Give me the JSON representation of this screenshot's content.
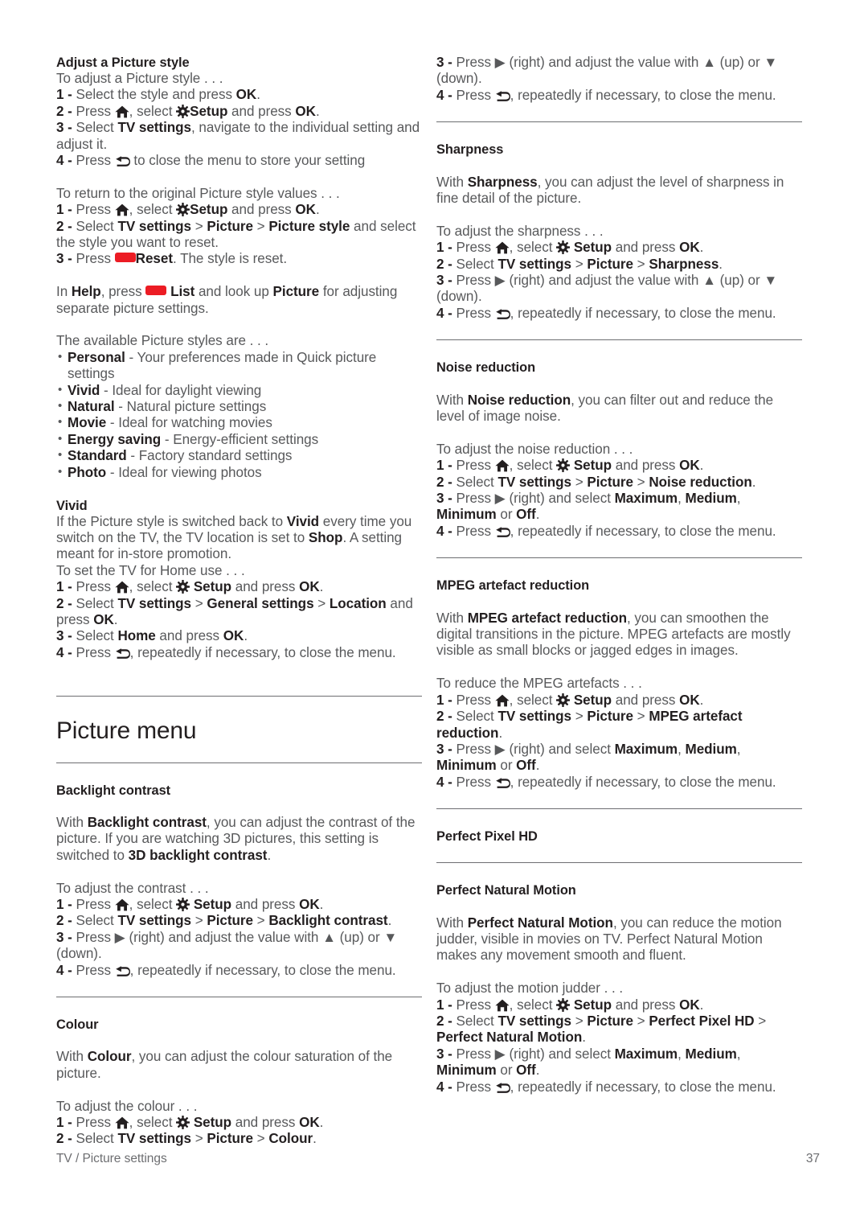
{
  "footer": {
    "breadcrumb": "TV / Picture settings",
    "page_number": "37"
  },
  "icons": {
    "home": "home-icon",
    "setup_gear": "gear-icon",
    "back": "back-arrow-icon",
    "red_key": "red-colour-key",
    "right": "▶",
    "up": "▲",
    "down": "▼"
  },
  "colors": {
    "red_key": "#ec1c24",
    "body_text": "#58595b",
    "heading_text": "#231f20",
    "rule": "#6d6e71"
  },
  "left_column": {
    "adjust_style": {
      "heading": "Adjust a Picture style",
      "intro": "To adjust a Picture style . . .",
      "step1_num": "1 -",
      "step1_a": "Select the style and press ",
      "step1_ok": "OK",
      "step1_end": ".",
      "step2_num": "2 -",
      "step2_a": "Press ",
      "step2_b": ", select ",
      "step2_setup": "Setup",
      "step2_c": " and press ",
      "step2_ok": "OK",
      "step2_end": ".",
      "step3_num": "3 -",
      "step3_a": "Select ",
      "step3_tv": "TV settings",
      "step3_b": ", navigate to the individual setting and adjust it.",
      "step4_num": "4 -",
      "step4_a": "Press ",
      "step4_b": " to close the menu to store your setting"
    },
    "return_original": {
      "intro": "To return to the original Picture style values . . .",
      "step1_num": "1 -",
      "step1_a": "Press ",
      "step1_b": ", select ",
      "step1_setup": "Setup",
      "step1_c": " and press ",
      "step1_ok": "OK",
      "step1_end": ".",
      "step2_num": "2 -",
      "step2_a": "Select ",
      "step2_tv": "TV settings",
      "step2_gt1": " > ",
      "step2_picture": "Picture",
      "step2_gt2": " > ",
      "step2_style": "Picture style",
      "step2_b": " and select the style you want to reset.",
      "step3_num": "3 -",
      "step3_a": "Press ",
      "step3_reset": "Reset",
      "step3_b": ". The style is reset."
    },
    "help_note": {
      "a": "In ",
      "help": "Help",
      "b": ", press ",
      "list": "List",
      "c": " and look up ",
      "picture": "Picture",
      "d": " for adjusting separate picture settings."
    },
    "styles_intro": "The available Picture styles are . . .",
    "styles": [
      {
        "name": "Personal",
        "desc": " - Your preferences made in Quick picture settings"
      },
      {
        "name": "Vivid",
        "desc": " - Ideal for daylight viewing"
      },
      {
        "name": "Natural",
        "desc": " - Natural picture settings"
      },
      {
        "name": "Movie",
        "desc": " - Ideal for watching movies"
      },
      {
        "name": "Energy saving",
        "desc": " - Energy-efficient settings"
      },
      {
        "name": "Standard",
        "desc": " - Factory standard settings"
      },
      {
        "name": "Photo",
        "desc": " - Ideal for viewing photos"
      }
    ],
    "vivid": {
      "heading": "Vivid",
      "body_a": "If the Picture style is switched back to ",
      "body_vivid": "Vivid",
      "body_b": " every time you switch on the TV, the TV location is set to ",
      "body_shop": "Shop",
      "body_c": ". A setting meant for in-store promotion.",
      "intro": "To set the TV for Home use . . .",
      "step1_num": "1 -",
      "step1_a": "Press ",
      "step1_b": ", select ",
      "step1_setup": "Setup",
      "step1_c": " and press ",
      "step1_ok": "OK",
      "step1_end": ".",
      "step2_num": "2 -",
      "step2_a": "Select ",
      "step2_tv": "TV settings",
      "step2_gt1": " > ",
      "step2_general": "General settings",
      "step2_gt2": " > ",
      "step2_location": "Location",
      "step2_b": " and press ",
      "step2_ok": "OK",
      "step2_end": ".",
      "step3_num": "3 -",
      "step3_a": "Select ",
      "step3_home": "Home",
      "step3_b": " and press ",
      "step3_ok": "OK",
      "step3_end": ".",
      "step4_num": "4 -",
      "step4_a": "Press ",
      "step4_b": ", repeatedly if necessary, to close the menu."
    },
    "picture_menu_title": "Picture menu",
    "backlight": {
      "heading": "Backlight contrast",
      "body_a": "With ",
      "body_term": "Backlight contrast",
      "body_b": ", you can adjust the contrast of the picture. If you are watching 3D pictures, this setting is switched to ",
      "body_term2": "3D backlight contrast",
      "body_c": ".",
      "intro": "To adjust the contrast . . .",
      "step1_num": "1 -",
      "step1_a": "Press ",
      "step1_b": ", select ",
      "step1_setup": "Setup",
      "step1_c": " and press ",
      "step1_ok": "OK",
      "step1_end": ".",
      "step2_num": "2 -",
      "step2_a": "Select ",
      "step2_tv": "TV settings",
      "step2_gt1": " > ",
      "step2_picture": "Picture",
      "step2_gt2": " > ",
      "step2_term": "Backlight contrast",
      "step2_end": ".",
      "step3_num": "3 -",
      "step3_a": "Press ",
      "step3_b": " (right) and adjust the value with ",
      "step3_c": " (up) or ",
      "step3_d": " (down).",
      "step4_num": "4 -",
      "step4_a": "Press ",
      "step4_b": ", repeatedly if necessary, to close the menu."
    },
    "colour": {
      "heading": "Colour",
      "body_a": "With ",
      "body_term": "Colour",
      "body_b": ", you can adjust the colour saturation of the picture.",
      "intro": "To adjust the colour . . .",
      "step1_num": "1 -",
      "step1_a": "Press ",
      "step1_b": ", select ",
      "step1_setup": "Setup",
      "step1_c": " and press ",
      "step1_ok": "OK",
      "step1_end": ".",
      "step2_num": "2 -",
      "step2_a": "Select ",
      "step2_tv": "TV settings",
      "step2_gt1": " > ",
      "step2_picture": "Picture",
      "step2_gt2": " > ",
      "step2_term": "Colour",
      "step2_end": "."
    }
  },
  "right_column": {
    "colour_cont": {
      "step3_num": "3 -",
      "step3_a": "Press ",
      "step3_b": " (right) and adjust the value with ",
      "step3_c": " (up) or ",
      "step3_d": " (down).",
      "step4_num": "4 -",
      "step4_a": "Press ",
      "step4_b": ", repeatedly if necessary, to close the menu."
    },
    "sharpness": {
      "heading": "Sharpness",
      "body_a": "With ",
      "body_term": "Sharpness",
      "body_b": ", you can adjust the level of sharpness in fine detail of the picture.",
      "intro": "To adjust the sharpness . . .",
      "step1_num": "1 -",
      "step1_a": "Press ",
      "step1_b": ", select ",
      "step1_setup": "Setup",
      "step1_c": " and press ",
      "step1_ok": "OK",
      "step1_end": ".",
      "step2_num": "2 -",
      "step2_a": "Select ",
      "step2_tv": "TV settings",
      "step2_gt1": " > ",
      "step2_picture": "Picture",
      "step2_gt2": " > ",
      "step2_term": "Sharpness",
      "step2_end": ".",
      "step3_num": "3 -",
      "step3_a": "Press ",
      "step3_b": " (right) and adjust the value with ",
      "step3_c": " (up) or ",
      "step3_d": " (down).",
      "step4_num": "4 -",
      "step4_a": "Press ",
      "step4_b": ", repeatedly if necessary, to close the menu."
    },
    "noise": {
      "heading": "Noise reduction",
      "body_a": "With ",
      "body_term": "Noise reduction",
      "body_b": ", you can filter out and reduce the level of image noise.",
      "intro": "To adjust the noise reduction . . .",
      "step1_num": "1 -",
      "step1_a": "Press ",
      "step1_b": ", select ",
      "step1_setup": "Setup",
      "step1_c": " and press ",
      "step1_ok": "OK",
      "step1_end": ".",
      "step2_num": "2 -",
      "step2_a": "Select ",
      "step2_tv": "TV settings",
      "step2_gt1": " > ",
      "step2_picture": "Picture",
      "step2_gt2": " > ",
      "step2_term": "Noise reduction",
      "step2_end": ".",
      "step3_num": "3 -",
      "step3_a": "Press ",
      "step3_b": " (right) and select ",
      "step3_max": "Maximum",
      "step3_sep1": ", ",
      "step3_med": "Medium",
      "step3_sep2": ", ",
      "step3_min": "Minimum",
      "step3_or": " or ",
      "step3_off": "Off",
      "step3_end": ".",
      "step4_num": "4 -",
      "step4_a": "Press ",
      "step4_b": ", repeatedly if necessary, to close the menu."
    },
    "mpeg": {
      "heading": "MPEG artefact reduction",
      "body_a": "With ",
      "body_term": "MPEG artefact reduction",
      "body_b": ", you can smoothen the digital transitions in the picture. MPEG artefacts are mostly visible as small blocks or jagged edges in images.",
      "intro": "To reduce the MPEG artefacts . . .",
      "step1_num": "1 -",
      "step1_a": "Press ",
      "step1_b": ", select ",
      "step1_setup": "Setup",
      "step1_c": " and press ",
      "step1_ok": "OK",
      "step1_end": ".",
      "step2_num": "2 -",
      "step2_a": "Select ",
      "step2_tv": "TV settings",
      "step2_gt1": " > ",
      "step2_picture": "Picture",
      "step2_gt2": " > ",
      "step2_term": "MPEG artefact reduction",
      "step2_end": ".",
      "step3_num": "3 -",
      "step3_a": "Press ",
      "step3_b": " (right) and select ",
      "step3_max": "Maximum",
      "step3_sep1": ", ",
      "step3_med": "Medium",
      "step3_sep2": ", ",
      "step3_min": "Minimum",
      "step3_or": " or ",
      "step3_off": "Off",
      "step3_end": ".",
      "step4_num": "4 -",
      "step4_a": "Press ",
      "step4_b": ", repeatedly if necessary, to close the menu."
    },
    "perfect_pixel_hd": {
      "heading": "Perfect Pixel HD"
    },
    "pnm": {
      "heading": "Perfect Natural Motion",
      "body_a": "With ",
      "body_term": "Perfect Natural Motion",
      "body_b": ", you can reduce the motion judder, visible in movies on TV. Perfect Natural Motion makes any movement smooth and fluent.",
      "intro": "To adjust the motion judder . . .",
      "step1_num": "1 -",
      "step1_a": "Press ",
      "step1_b": ", select ",
      "step1_setup": "Setup",
      "step1_c": " and press ",
      "step1_ok": "OK",
      "step1_end": ".",
      "step2_num": "2 -",
      "step2_a": "Select ",
      "step2_tv": "TV settings",
      "step2_gt1": " > ",
      "step2_picture": "Picture",
      "step2_gt2": " > ",
      "step2_pphd": "Perfect Pixel HD",
      "step2_gt3": " > ",
      "step2_term": "Perfect Natural Motion",
      "step2_end": ".",
      "step3_num": "3 -",
      "step3_a": "Press ",
      "step3_b": " (right) and select ",
      "step3_max": "Maximum",
      "step3_sep1": ", ",
      "step3_med": "Medium",
      "step3_sep2": ", ",
      "step3_min": "Minimum",
      "step3_or": " or ",
      "step3_off": "Off",
      "step3_end": ".",
      "step4_num": "4 -",
      "step4_a": "Press ",
      "step4_b": ", repeatedly if necessary, to close the menu."
    }
  }
}
